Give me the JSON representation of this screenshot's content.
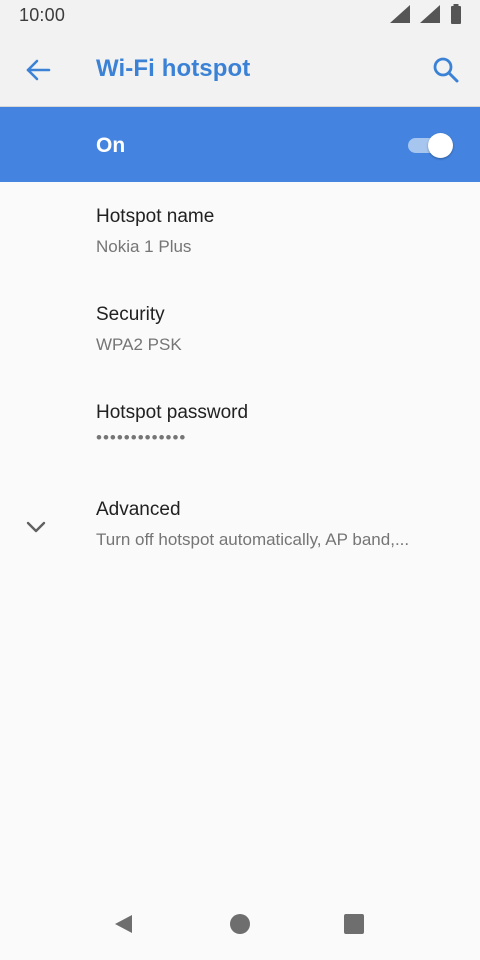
{
  "status_bar": {
    "time": "10:00",
    "icons": [
      "signal-icon",
      "signal-icon",
      "battery-icon"
    ]
  },
  "app_bar": {
    "back_icon": "arrow-back-icon",
    "title": "Wi-Fi hotspot",
    "search_icon": "search-icon"
  },
  "master_switch": {
    "label": "On",
    "checked": true
  },
  "settings": [
    {
      "title": "Hotspot name",
      "subtitle": "Nokia 1 Plus"
    },
    {
      "title": "Security",
      "subtitle": "WPA2 PSK"
    },
    {
      "title": "Hotspot password",
      "subtitle": "•••••••••••••"
    },
    {
      "title": "Advanced",
      "subtitle": "Turn off hotspot automatically, AP band,..."
    }
  ],
  "nav_bar": {
    "back_icon": "nav-back-icon",
    "home_icon": "nav-home-icon",
    "recents_icon": "nav-recents-icon"
  },
  "colors": {
    "accent": "#3b82d6",
    "switch_bar": "#4484e0",
    "background": "#fafafa",
    "bar": "#f2f2f2"
  }
}
